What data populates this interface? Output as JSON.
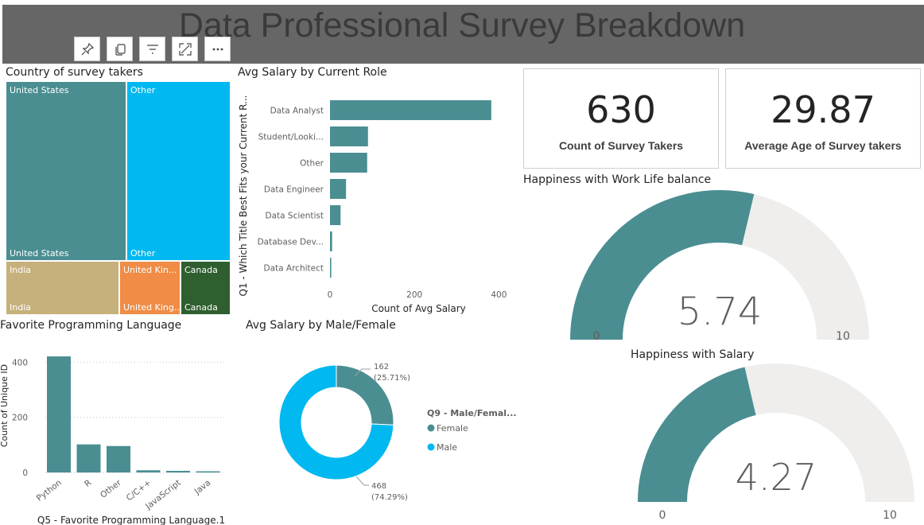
{
  "header": {
    "title": "Data Professional Survey Breakdown"
  },
  "toolbar": {
    "icons": [
      "pin-icon",
      "copy-icon",
      "filter-icon",
      "focus-mode-icon",
      "more-options-icon"
    ]
  },
  "colors": {
    "teal": "#4a8e92",
    "blue": "#01b8f0",
    "tan": "#c6b07b",
    "orange": "#f08c46",
    "green": "#2f5e2f",
    "gauge_bg": "#efeeed"
  },
  "visuals": {
    "treemap_title": "Country of survey takers",
    "role_title": "Avg Salary by Current Role",
    "lang_title": "Favorite Programming Language",
    "gender_title": "Avg Salary by Male/Female",
    "gauge1_title": "Happiness with Work Life balance",
    "gauge2_title": "Happiness with Salary"
  },
  "cards": [
    {
      "value": "630",
      "label": "Count of Survey Takers"
    },
    {
      "value": "29.87",
      "label": "Average Age of Survey takers"
    }
  ],
  "chart_data": [
    {
      "type": "treemap",
      "title": "Country of survey takers",
      "items": [
        {
          "name": "United States",
          "top_label": "United States",
          "bottom_label": "United States"
        },
        {
          "name": "Other",
          "top_label": "Other",
          "bottom_label": "Other"
        },
        {
          "name": "India",
          "top_label": "India",
          "bottom_label": "India"
        },
        {
          "name": "United Kingdom",
          "top_label": "United Kin...",
          "bottom_label": "United King..."
        },
        {
          "name": "Canada",
          "top_label": "Canada",
          "bottom_label": "Canada"
        }
      ]
    },
    {
      "type": "bar",
      "orientation": "horizontal",
      "title": "Avg Salary by Current Role",
      "ylabel": "Q1 - Which Title Best Fits your Current R...",
      "xlabel": "Count of Avg Salary",
      "categories": [
        "Data Analyst",
        "Student/Looki...",
        "Other",
        "Data Engineer",
        "Data Scientist",
        "Database Dev...",
        "Data Architect"
      ],
      "values": [
        382,
        90,
        88,
        38,
        25,
        5,
        3
      ],
      "xlim": [
        0,
        420
      ],
      "xticks": [
        "0",
        "200",
        "400"
      ]
    },
    {
      "type": "bar",
      "title": "Favorite Programming Language",
      "xlabel": "Q5 - Favorite Programming Language.1",
      "ylabel": "Count of Unique ID",
      "categories": [
        "Python",
        "R",
        "Other",
        "C/C++",
        "JavaScript",
        "Java"
      ],
      "values": [
        421,
        102,
        96,
        8,
        6,
        3
      ],
      "ylim": [
        0,
        450
      ],
      "yticks": [
        "0",
        "200",
        "400"
      ]
    },
    {
      "type": "pie",
      "variant": "donut",
      "title": "Avg Salary by Male/Female",
      "legend_title": "Q9 - Male/Femal...",
      "legend_position": "right",
      "slices": [
        {
          "name": "Female",
          "value": 162,
          "label_value": "162",
          "label_pct": "(25.71%)"
        },
        {
          "name": "Male",
          "value": 468,
          "label_value": "468",
          "label_pct": "(74.29%)"
        }
      ]
    },
    {
      "type": "gauge",
      "title": "Happiness with Work Life balance",
      "value": 5.74,
      "value_label": "5.74",
      "min": 0,
      "max": 10,
      "min_label": "0",
      "max_label": "10"
    },
    {
      "type": "gauge",
      "title": "Happiness with Salary",
      "value": 4.27,
      "value_label": "4.27",
      "min": 0,
      "max": 10,
      "min_label": "0",
      "max_label": "10"
    }
  ]
}
